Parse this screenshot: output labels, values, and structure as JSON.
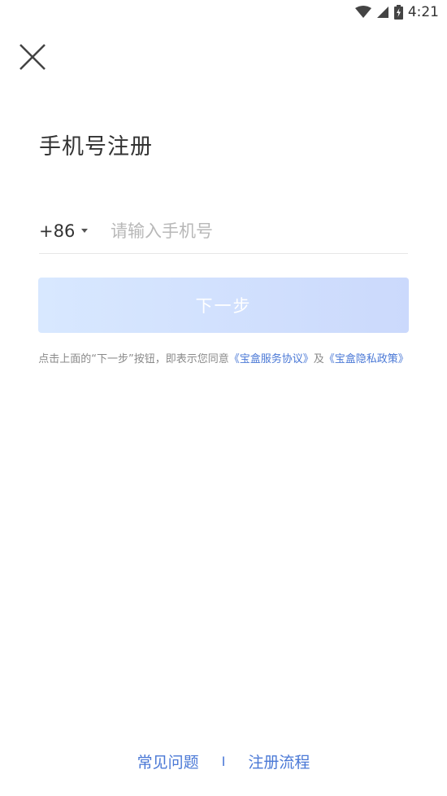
{
  "status_bar": {
    "time": "4:21",
    "icons": [
      "wifi-icon",
      "cellular-signal-icon",
      "battery-charging-icon"
    ]
  },
  "header": {
    "close_icon": "close-icon"
  },
  "title": "手机号注册",
  "phone": {
    "country_code": "+86",
    "placeholder": "请输入手机号",
    "value": ""
  },
  "next_button": {
    "label": "下一步",
    "enabled": false
  },
  "agreement": {
    "prefix": "点击上面的“下一步”按钮，即表示您同意",
    "service_link": "《宝盒服务协议》",
    "and": "及",
    "privacy_link": "《宝盒隐私政策》"
  },
  "footer": {
    "faq": "常见问题",
    "separator": "I",
    "process": "注册流程"
  },
  "colors": {
    "link": "#4a78d6",
    "button_start": "#d8e8ff",
    "button_end": "#cbd9fc"
  }
}
